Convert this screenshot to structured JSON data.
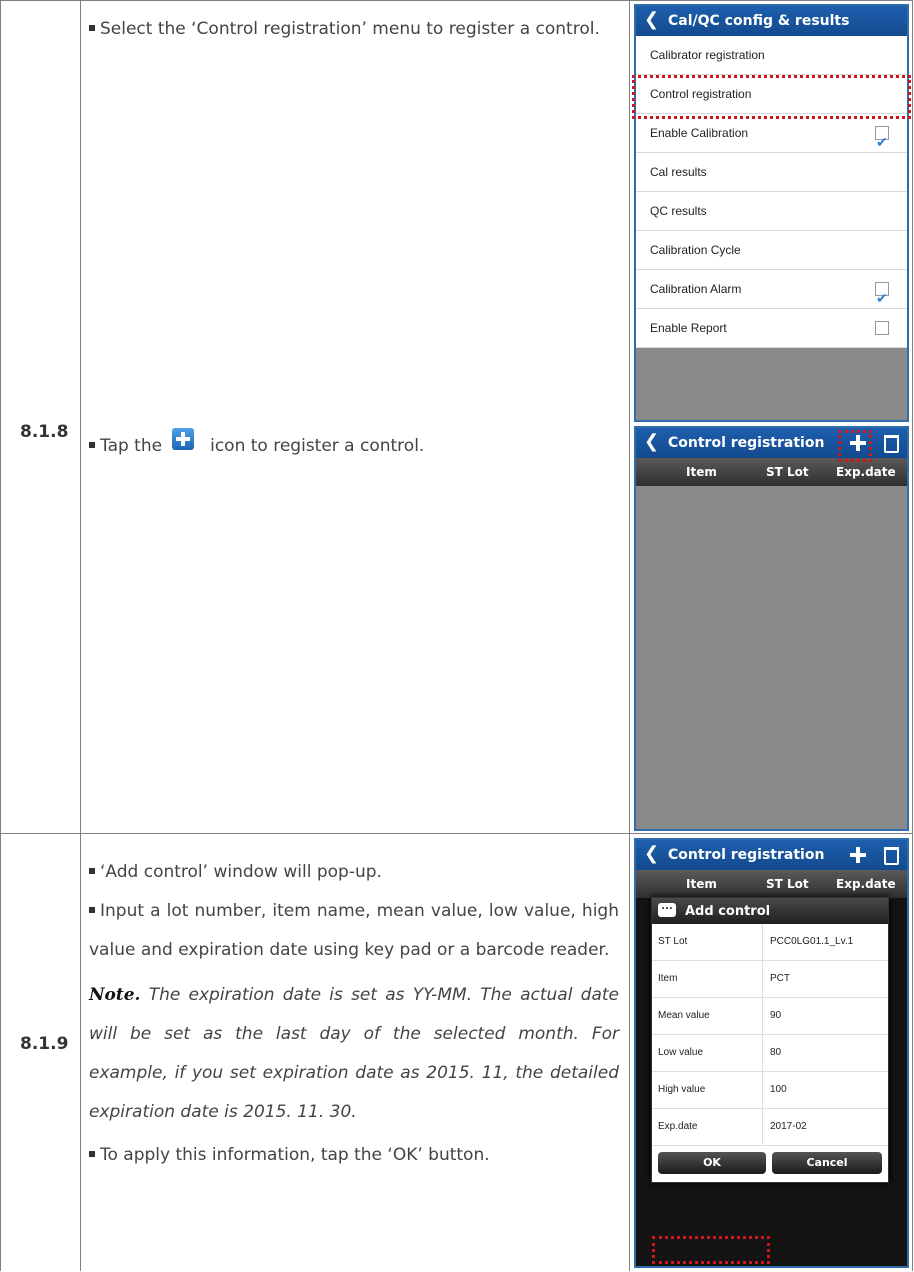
{
  "rows": [
    {
      "section": "8.1.8",
      "steps": [
        {
          "text": "Select the ‘Control registration’ menu to register a control."
        },
        {
          "text_before": "Tap the",
          "text_after": "icon to register a control.",
          "icon": "plus-icon"
        }
      ]
    },
    {
      "section": "8.1.9",
      "steps": [
        {
          "text": "‘Add control’ window will pop-up."
        },
        {
          "text": "Input a lot number, item name, mean value, low value, high value and expiration date using key pad or a barcode reader."
        },
        {
          "text": "To apply this information, tap the ‘OK’ button."
        }
      ],
      "note_label": "Note.",
      "note_text": "The expiration date is set as YY-MM. The actual date will be set as the last day of the selected month. For example, if you set expiration date as 2015. 11, the detailed expiration date is 2015. 11. 30."
    }
  ],
  "screen1": {
    "title": "Cal/QC config & results",
    "items": [
      {
        "label": "Calibrator registration",
        "checkbox": null
      },
      {
        "label": "Control registration",
        "checkbox": null,
        "highlighted": true
      },
      {
        "label": "Enable Calibration",
        "checkbox": true
      },
      {
        "label": "Cal results",
        "checkbox": null
      },
      {
        "label": "QC results",
        "checkbox": null
      },
      {
        "label": "Calibration Cycle",
        "checkbox": null
      },
      {
        "label": "Calibration Alarm",
        "checkbox": true
      },
      {
        "label": "Enable Report",
        "checkbox": false
      }
    ]
  },
  "screen2": {
    "title": "Control registration",
    "columns": [
      "Item",
      "ST Lot",
      "Exp.date"
    ]
  },
  "screen3": {
    "title": "Control registration",
    "columns": [
      "Item",
      "ST Lot",
      "Exp.date"
    ],
    "dialog": {
      "title": "Add control",
      "fields": [
        {
          "label": "ST Lot",
          "value": "PCC0LG01.1_Lv.1"
        },
        {
          "label": "Item",
          "value": "PCT"
        },
        {
          "label": "Mean value",
          "value": "90"
        },
        {
          "label": "Low value",
          "value": "80"
        },
        {
          "label": "High value",
          "value": "100"
        },
        {
          "label": "Exp.date",
          "value": "2017-02"
        }
      ],
      "ok_label": "OK",
      "cancel_label": "Cancel"
    }
  },
  "colors": {
    "appbar": "#1e5fae",
    "highlight": "#d0161b",
    "checkbox": "#2a7fd4"
  }
}
